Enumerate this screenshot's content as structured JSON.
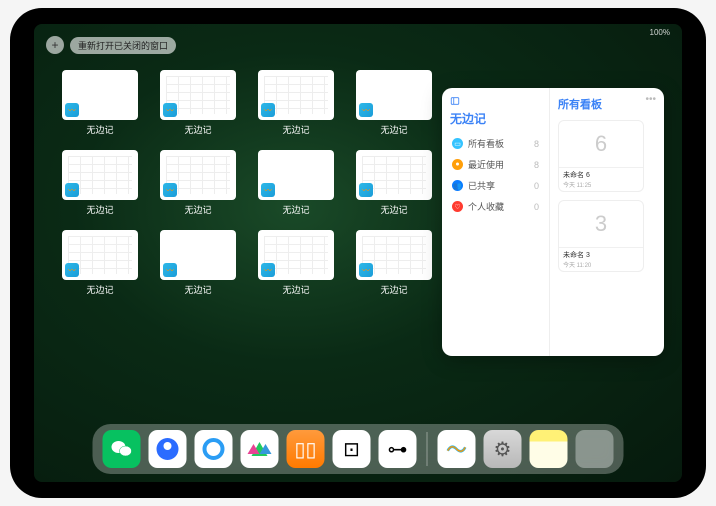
{
  "status": {
    "battery": "100%",
    "signal": "●●●●"
  },
  "top": {
    "plus": "+",
    "reopen_label": "重新打开已关闭的窗口"
  },
  "app": {
    "name": "无边记",
    "thumbs": [
      {
        "variant": "blank"
      },
      {
        "variant": "calendar"
      },
      {
        "variant": "calendar"
      },
      {
        "variant": "blank"
      },
      {
        "variant": "calendar"
      },
      {
        "variant": "calendar"
      },
      {
        "variant": "blank"
      },
      {
        "variant": "calendar"
      },
      {
        "variant": "calendar"
      },
      {
        "variant": "blank"
      },
      {
        "variant": "calendar"
      },
      {
        "variant": "calendar"
      }
    ]
  },
  "popup": {
    "left_title": "无边记",
    "items": [
      {
        "icon_color": "#34c3ff",
        "glyph": "▭",
        "label": "所有看板",
        "count": 8
      },
      {
        "icon_color": "#ff9f0a",
        "glyph": "●",
        "label": "最近使用",
        "count": 8
      },
      {
        "icon_color": "#0a7cff",
        "glyph": "👥",
        "label": "已共享",
        "count": 0
      },
      {
        "icon_color": "#ff3b30",
        "glyph": "♡",
        "label": "个人收藏",
        "count": 0
      }
    ],
    "right_title": "所有看板",
    "boards": [
      {
        "sketch": "6",
        "name": "未命名 6",
        "date": "今天 11:25"
      },
      {
        "sketch": "3",
        "name": "未命名 3",
        "date": "今天 11:20"
      }
    ]
  },
  "dock": [
    {
      "id": "wechat",
      "glyph": "✶"
    },
    {
      "id": "qqhd",
      "glyph": ""
    },
    {
      "id": "qbrowser",
      "glyph": ""
    },
    {
      "id": "iqiyi",
      "glyph": ""
    },
    {
      "id": "books",
      "glyph": "▯▯"
    },
    {
      "id": "dice",
      "glyph": "⊡"
    },
    {
      "id": "graph",
      "glyph": "⊶"
    },
    {
      "id": "freeform",
      "glyph": ""
    },
    {
      "id": "settings",
      "glyph": "⚙"
    },
    {
      "id": "notes",
      "glyph": ""
    },
    {
      "id": "applibrary",
      "glyph": ""
    }
  ]
}
